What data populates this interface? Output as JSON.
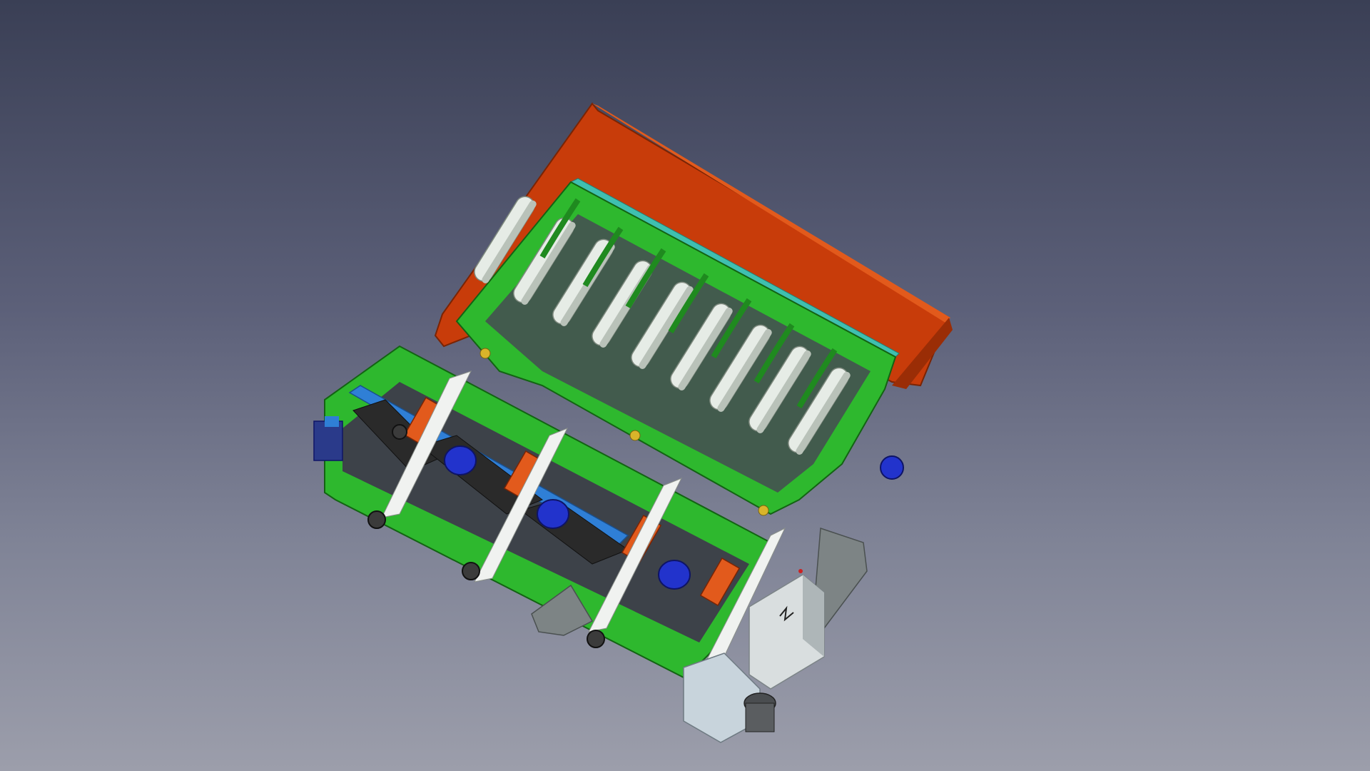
{
  "viewport": {
    "background_top": "#3a3f55",
    "background_bottom": "#9c9eab"
  },
  "model": {
    "colors": {
      "frame": "#2eb82e",
      "frame_dark": "#1f8a1f",
      "hopper": "#c83c0a",
      "hopper_dark": "#9a2d06",
      "roller": "#e6ece6",
      "roller_shadow": "#b9c2b9",
      "conveyor_belt": "#2a2a2a",
      "motor": "#2233cc",
      "blue_channel": "#2f7fd6",
      "cabinet": "#d9dedf",
      "cabinet_shadow": "#aeb6b8",
      "chute": "#7d8485",
      "teal_slats": "#3fbfb0",
      "orange_parts": "#e25a1c"
    },
    "roller_count": 9,
    "cutter_unit_count": 4,
    "cabinet_symbol": "lightning-bolt-icon"
  }
}
